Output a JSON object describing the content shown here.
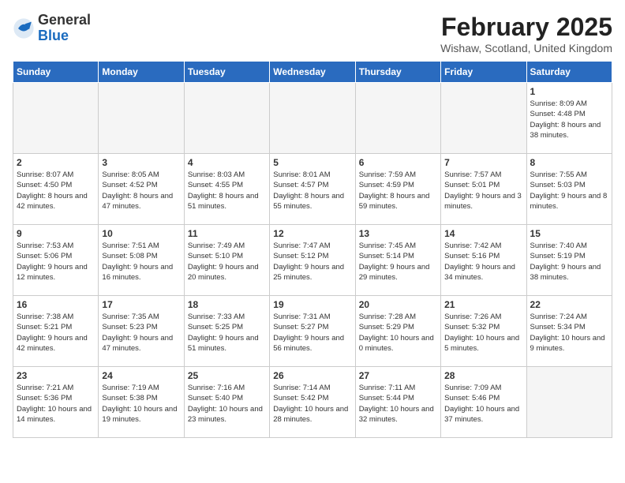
{
  "logo": {
    "general": "General",
    "blue": "Blue"
  },
  "header": {
    "title": "February 2025",
    "location": "Wishaw, Scotland, United Kingdom"
  },
  "days_of_week": [
    "Sunday",
    "Monday",
    "Tuesday",
    "Wednesday",
    "Thursday",
    "Friday",
    "Saturday"
  ],
  "weeks": [
    [
      {
        "day": "",
        "info": ""
      },
      {
        "day": "",
        "info": ""
      },
      {
        "day": "",
        "info": ""
      },
      {
        "day": "",
        "info": ""
      },
      {
        "day": "",
        "info": ""
      },
      {
        "day": "",
        "info": ""
      },
      {
        "day": "1",
        "info": "Sunrise: 8:09 AM\nSunset: 4:48 PM\nDaylight: 8 hours and 38 minutes."
      }
    ],
    [
      {
        "day": "2",
        "info": "Sunrise: 8:07 AM\nSunset: 4:50 PM\nDaylight: 8 hours and 42 minutes."
      },
      {
        "day": "3",
        "info": "Sunrise: 8:05 AM\nSunset: 4:52 PM\nDaylight: 8 hours and 47 minutes."
      },
      {
        "day": "4",
        "info": "Sunrise: 8:03 AM\nSunset: 4:55 PM\nDaylight: 8 hours and 51 minutes."
      },
      {
        "day": "5",
        "info": "Sunrise: 8:01 AM\nSunset: 4:57 PM\nDaylight: 8 hours and 55 minutes."
      },
      {
        "day": "6",
        "info": "Sunrise: 7:59 AM\nSunset: 4:59 PM\nDaylight: 8 hours and 59 minutes."
      },
      {
        "day": "7",
        "info": "Sunrise: 7:57 AM\nSunset: 5:01 PM\nDaylight: 9 hours and 3 minutes."
      },
      {
        "day": "8",
        "info": "Sunrise: 7:55 AM\nSunset: 5:03 PM\nDaylight: 9 hours and 8 minutes."
      }
    ],
    [
      {
        "day": "9",
        "info": "Sunrise: 7:53 AM\nSunset: 5:06 PM\nDaylight: 9 hours and 12 minutes."
      },
      {
        "day": "10",
        "info": "Sunrise: 7:51 AM\nSunset: 5:08 PM\nDaylight: 9 hours and 16 minutes."
      },
      {
        "day": "11",
        "info": "Sunrise: 7:49 AM\nSunset: 5:10 PM\nDaylight: 9 hours and 20 minutes."
      },
      {
        "day": "12",
        "info": "Sunrise: 7:47 AM\nSunset: 5:12 PM\nDaylight: 9 hours and 25 minutes."
      },
      {
        "day": "13",
        "info": "Sunrise: 7:45 AM\nSunset: 5:14 PM\nDaylight: 9 hours and 29 minutes."
      },
      {
        "day": "14",
        "info": "Sunrise: 7:42 AM\nSunset: 5:16 PM\nDaylight: 9 hours and 34 minutes."
      },
      {
        "day": "15",
        "info": "Sunrise: 7:40 AM\nSunset: 5:19 PM\nDaylight: 9 hours and 38 minutes."
      }
    ],
    [
      {
        "day": "16",
        "info": "Sunrise: 7:38 AM\nSunset: 5:21 PM\nDaylight: 9 hours and 42 minutes."
      },
      {
        "day": "17",
        "info": "Sunrise: 7:35 AM\nSunset: 5:23 PM\nDaylight: 9 hours and 47 minutes."
      },
      {
        "day": "18",
        "info": "Sunrise: 7:33 AM\nSunset: 5:25 PM\nDaylight: 9 hours and 51 minutes."
      },
      {
        "day": "19",
        "info": "Sunrise: 7:31 AM\nSunset: 5:27 PM\nDaylight: 9 hours and 56 minutes."
      },
      {
        "day": "20",
        "info": "Sunrise: 7:28 AM\nSunset: 5:29 PM\nDaylight: 10 hours and 0 minutes."
      },
      {
        "day": "21",
        "info": "Sunrise: 7:26 AM\nSunset: 5:32 PM\nDaylight: 10 hours and 5 minutes."
      },
      {
        "day": "22",
        "info": "Sunrise: 7:24 AM\nSunset: 5:34 PM\nDaylight: 10 hours and 9 minutes."
      }
    ],
    [
      {
        "day": "23",
        "info": "Sunrise: 7:21 AM\nSunset: 5:36 PM\nDaylight: 10 hours and 14 minutes."
      },
      {
        "day": "24",
        "info": "Sunrise: 7:19 AM\nSunset: 5:38 PM\nDaylight: 10 hours and 19 minutes."
      },
      {
        "day": "25",
        "info": "Sunrise: 7:16 AM\nSunset: 5:40 PM\nDaylight: 10 hours and 23 minutes."
      },
      {
        "day": "26",
        "info": "Sunrise: 7:14 AM\nSunset: 5:42 PM\nDaylight: 10 hours and 28 minutes."
      },
      {
        "day": "27",
        "info": "Sunrise: 7:11 AM\nSunset: 5:44 PM\nDaylight: 10 hours and 32 minutes."
      },
      {
        "day": "28",
        "info": "Sunrise: 7:09 AM\nSunset: 5:46 PM\nDaylight: 10 hours and 37 minutes."
      },
      {
        "day": "",
        "info": ""
      }
    ]
  ]
}
